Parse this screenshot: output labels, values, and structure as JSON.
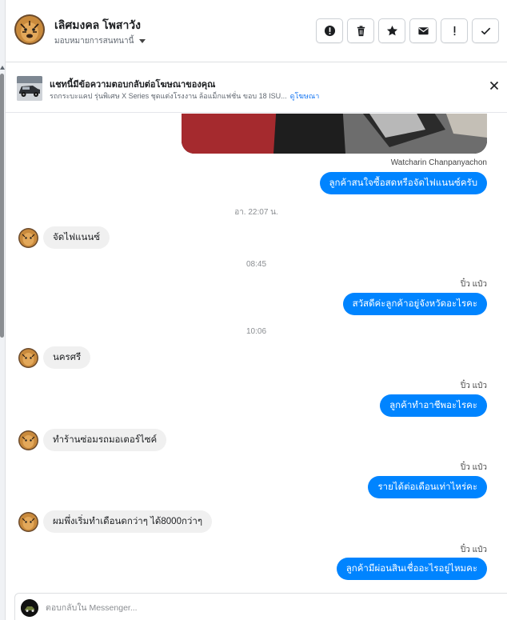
{
  "header": {
    "contact_name": "เลิศมงคล โพสาวัง",
    "assign_label": "มอบหมายการสนทนานี้",
    "actions": [
      {
        "name": "report-button",
        "icon": "alert-circle-icon"
      },
      {
        "name": "delete-button",
        "icon": "trash-icon"
      },
      {
        "name": "star-button",
        "icon": "star-icon"
      },
      {
        "name": "mark-unread-button",
        "icon": "envelope-icon"
      },
      {
        "name": "mark-spam-button",
        "icon": "exclamation-icon"
      },
      {
        "name": "mark-done-button",
        "icon": "check-icon"
      }
    ]
  },
  "ad": {
    "title": "แชทนี้มีข้อความตอบกลับต่อโฆษณาของคุณ",
    "description": "รถกระบะแคป รุ่นพิเศษ X Series ชุดแต่งโรงงาน ล้อแม็กแฟชั่น ขอบ 18 ISU...",
    "link": "ดูโฆษณา"
  },
  "chat": {
    "photo_sender": "Watcharin Chanpanyachon",
    "messages": [
      {
        "type": "outgoing",
        "text": "ลูกค้าสนใจซื้อสดหรือจัดไฟแนนซ์ครับ"
      },
      {
        "type": "timestamp",
        "text": "อา. 22:07 น."
      },
      {
        "type": "incoming",
        "text": "จัดไฟแนนซ์"
      },
      {
        "type": "timestamp",
        "text": "08:45"
      },
      {
        "type": "sender",
        "text": "ปิ๋ว แป๋ว"
      },
      {
        "type": "outgoing",
        "text": "สวัสดีค่ะลูกค้าอยู่จังหวัดอะไรคะ"
      },
      {
        "type": "timestamp",
        "text": "10:06"
      },
      {
        "type": "incoming",
        "text": "นครศรี"
      },
      {
        "type": "sender",
        "text": "ปิ๋ว แป๋ว"
      },
      {
        "type": "outgoing",
        "text": "ลูกค้าทำอาชีพอะไรคะ"
      },
      {
        "type": "incoming",
        "text": "ทำร้านซ่อมรถมอเตอร์ไซค์"
      },
      {
        "type": "sender",
        "text": "ปิ๋ว แป๋ว"
      },
      {
        "type": "outgoing",
        "text": "รายได้ต่อเดือนเท่าไหร่คะ"
      },
      {
        "type": "incoming",
        "text": "ผมพึ่งเริ่มทำเดือนดกว่าๆ ได้8000กว่าๆ"
      },
      {
        "type": "sender",
        "text": "ปิ๋ว แป๋ว"
      },
      {
        "type": "outgoing",
        "text": "ลูกค้ามีผ่อนสินเชื่ออะไรอยู่ไหมคะ"
      }
    ]
  },
  "composer": {
    "placeholder": "ตอบกลับใน Messenger..."
  },
  "colors": {
    "outgoing_bubble": "#0084ff",
    "incoming_bubble": "#f0f0f0",
    "link": "#1877f2"
  }
}
